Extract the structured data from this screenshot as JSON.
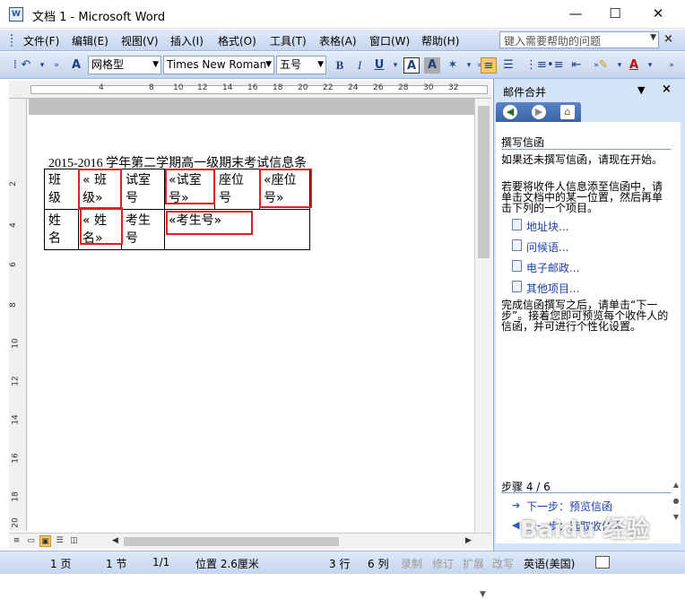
{
  "window": {
    "title": "文档 1 - Microsoft Word",
    "app_icon_letter": "W"
  },
  "menu": {
    "items": [
      "文件(F)",
      "编辑(E)",
      "视图(V)",
      "插入(I)",
      "格式(O)",
      "工具(T)",
      "表格(A)",
      "窗口(W)",
      "帮助(H)"
    ],
    "help_placeholder": "键入需要帮助的问题"
  },
  "toolbar": {
    "style": "网格型",
    "font": "Times New Roman",
    "size": "五号",
    "bold": "B",
    "italic": "I",
    "underline": "U",
    "font_color_letter": "A"
  },
  "ruler": {
    "ticks": [
      "4",
      "8",
      "10",
      "12",
      "14",
      "16",
      "18",
      "20",
      "22",
      "24",
      "26",
      "28",
      "30",
      "32"
    ],
    "vticks": [
      "2",
      "4",
      "6",
      "8",
      "10",
      "12",
      "14",
      "16",
      "18",
      "20"
    ]
  },
  "document": {
    "heading": "2015-2016 学年第二学期高一级期末考试信息条",
    "row1": [
      "班　级",
      "« 班　级»",
      "试室　号",
      "«试室　号»",
      "座位　号",
      "«座位　号»"
    ],
    "row2": [
      "姓　名",
      "« 姓　名»",
      "考生　号",
      "«考生号»"
    ]
  },
  "statusbar": {
    "page": "1 页",
    "section": "1 节",
    "pages": "1/1",
    "position": "位置 2.6厘米",
    "line": "3 行",
    "column": "6 列",
    "rec": "录制",
    "trk": "修订",
    "ext": "扩展",
    "ovr": "改写",
    "lang": "英语(美国)"
  },
  "taskpane": {
    "title": "邮件合并",
    "section_title": "撰写信函",
    "para1": "如果还未撰写信函，请现在开始。",
    "para2": "若要将收件人信息添至信函中，请单击文档中的某一位置，然后再单击下列的一个项目。",
    "links": [
      "地址块...",
      "问候语...",
      "电子邮政...",
      "其他项目..."
    ],
    "para3": "完成信函撰写之后，请单击“下一步”。接着您即可预览每个收件人的信函，并可进行个性化设置。",
    "step": "步骤 4 / 6",
    "next": "下一步：预览信函",
    "prev": "上一步：选取收件人"
  },
  "watermark": "Baidu 经验"
}
